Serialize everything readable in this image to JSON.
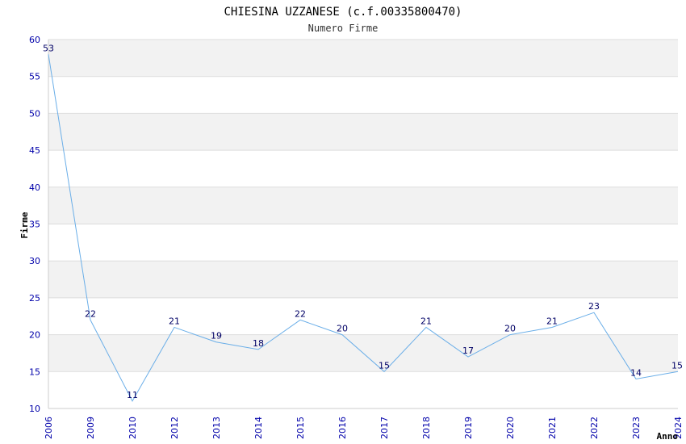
{
  "chart_data": {
    "type": "line",
    "title": "CHIESINA UZZANESE (c.f.00335800470)",
    "subtitle": "Numero Firme",
    "xlabel": "Anno",
    "ylabel": "Firme",
    "categories": [
      "2006",
      "2009",
      "2010",
      "2012",
      "2013",
      "2014",
      "2015",
      "2016",
      "2017",
      "2018",
      "2019",
      "2020",
      "2021",
      "2022",
      "2023",
      "2024"
    ],
    "series": [
      {
        "values": [
          58,
          22,
          11,
          21,
          19,
          18,
          22,
          20,
          15,
          21,
          17,
          20,
          21,
          23,
          14,
          15
        ]
      }
    ],
    "data_labels": [
      "53",
      "22",
      "11",
      "21",
      "19",
      "18",
      "22",
      "20",
      "15",
      "21",
      "17",
      "20",
      "21",
      "23",
      "14",
      "15"
    ],
    "ylim": [
      10,
      60
    ],
    "yticks": [
      10,
      15,
      20,
      25,
      30,
      35,
      40,
      45,
      50,
      55,
      60
    ],
    "grid": true,
    "band_color": "#f2f2f2",
    "line_color": "#6aaee8"
  }
}
